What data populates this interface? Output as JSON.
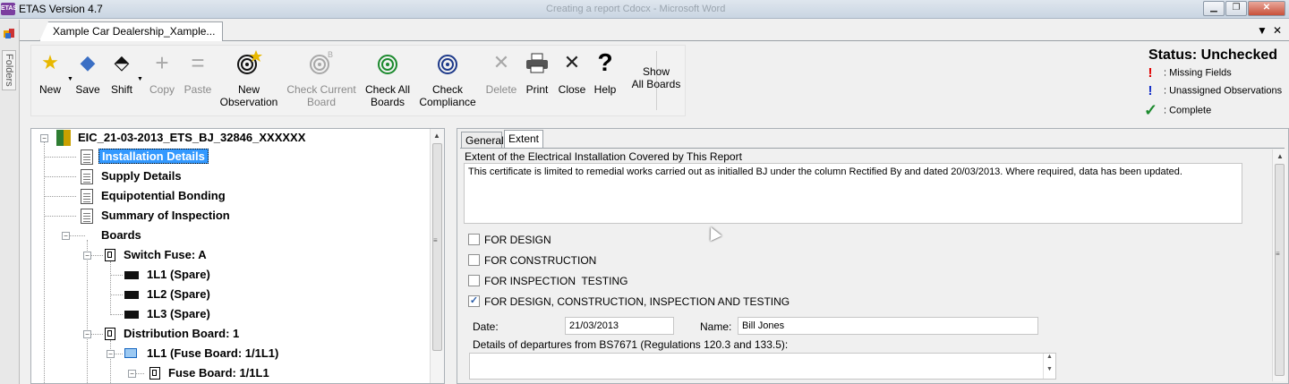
{
  "window": {
    "app_icon_text": "ETAS",
    "title": "ETAS Version 4.7",
    "background_title": "Creating a report Cdocx - Microsoft Word",
    "controls": {
      "minimize": "▁",
      "restore": "❐",
      "close": "✕"
    }
  },
  "folders": {
    "label": "Folders"
  },
  "document_tab": {
    "title": "Xample Car Dealership_Xample...",
    "menu_arrow": "▼",
    "close": "✕"
  },
  "toolbar": {
    "items": [
      {
        "label": "New",
        "icon": "star-icon",
        "glyph": "★",
        "color": "#e8b800",
        "enabled": true
      },
      {
        "label": "Save",
        "icon": "save-icon",
        "glyph": "◆",
        "color": "#3b6fc4",
        "enabled": true
      },
      {
        "label": "Shift",
        "icon": "shift-icon",
        "glyph": "⬘",
        "color": "#111111",
        "enabled": true
      },
      {
        "label": "Copy",
        "icon": "copy-icon",
        "glyph": "+",
        "color": "#a8a8a8",
        "enabled": false
      },
      {
        "label": "Paste",
        "icon": "paste-icon",
        "glyph": "=",
        "color": "#a8a8a8",
        "enabled": false
      },
      {
        "label": "New Observation",
        "line1": "New",
        "line2": "Observation",
        "icon": "new-observation-icon",
        "glyph": "@",
        "color": "#111111",
        "enabled": true
      },
      {
        "label": "Check Current Board",
        "line1": "Check Current",
        "line2": "Board",
        "icon": "check-current-board-icon",
        "glyph": "@",
        "color": "#a8a8a8",
        "enabled": false
      },
      {
        "label": "Check All Boards",
        "line1": "Check All",
        "line2": "Boards",
        "icon": "check-all-boards-icon",
        "glyph": "@",
        "color": "#1c8a2e",
        "enabled": true
      },
      {
        "label": "Check Compliance",
        "line1": "Check",
        "line2": "Compliance",
        "icon": "check-compliance-icon",
        "glyph": "@",
        "color": "#1e3a8a",
        "enabled": true
      },
      {
        "label": "Delete",
        "icon": "delete-icon",
        "glyph": "✕",
        "color": "#a8a8a8",
        "enabled": false
      },
      {
        "label": "Print",
        "icon": "print-icon",
        "glyph": "⎙",
        "color": "#333333",
        "enabled": true
      },
      {
        "label": "Close",
        "icon": "close-icon",
        "glyph": "✕",
        "color": "#222222",
        "enabled": true
      },
      {
        "label": "Help",
        "icon": "help-icon",
        "glyph": "?",
        "color": "#000000",
        "enabled": true
      }
    ],
    "show_all_boards": {
      "line1": "Show",
      "line2": "All Boards"
    }
  },
  "status": {
    "title": "Status: Unchecked",
    "legend": [
      {
        "mark": "!",
        "color": "#e00000",
        "text": ": Missing Fields"
      },
      {
        "mark": "!",
        "color": "#1530c8",
        "text": ": Unassigned Observations"
      },
      {
        "mark": "✓",
        "color": "#1c8a2e",
        "text": ": Complete"
      }
    ]
  },
  "tree": {
    "root": "EIC_21-03-2013_ETS_BJ_32846_XXXXXX",
    "sections": [
      "Installation Details",
      "Supply Details",
      "Equipotential Bonding",
      "Summary of Inspection"
    ],
    "boards_label": "Boards",
    "switch_fuse": "Switch Fuse: A",
    "ways": [
      "1L1 (Spare)",
      "1L2 (Spare)",
      "1L3 (Spare)"
    ],
    "distribution_board": "Distribution Board: 1",
    "fuse_board_way": "1L1 (Fuse Board: 1/1L1)",
    "fuse_board": "Fuse Board: 1/1L1"
  },
  "tabs": {
    "general": "General",
    "extent": "Extent"
  },
  "extent": {
    "heading": "Extent of the Electrical Installation Covered by This Report",
    "text": "This certificate is limited to remedial works carried out as initialled BJ under the column Rectified By and dated 20/03/2013. Where required, data has been updated.",
    "checkboxes": [
      {
        "label": "FOR DESIGN",
        "checked": false
      },
      {
        "label": "FOR CONSTRUCTION",
        "checked": false
      },
      {
        "label": "FOR INSPECTION  TESTING",
        "checked": false
      },
      {
        "label": "FOR DESIGN, CONSTRUCTION, INSPECTION AND TESTING",
        "checked": true
      }
    ],
    "date_label": "Date:",
    "date_value": "21/03/2013",
    "name_label": "Name:",
    "name_value": "Bill Jones",
    "departures_label": "Details of departures from BS7671 (Regulations 120.3 and 133.5):",
    "departures_value": ""
  }
}
